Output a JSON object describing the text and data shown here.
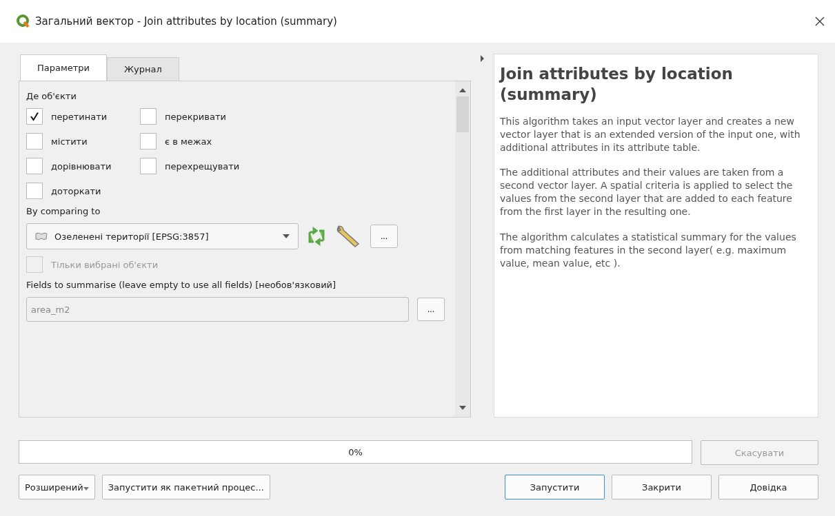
{
  "window": {
    "title": "Загальний вектор - Join attributes by location (summary)"
  },
  "tabs": [
    {
      "label": "Параметри",
      "selected": true
    },
    {
      "label": "Журнал",
      "selected": false
    }
  ],
  "predicate": {
    "label": "Де об'єкти",
    "options": [
      {
        "label": "перетинати",
        "checked": true
      },
      {
        "label": "перекривати",
        "checked": false
      },
      {
        "label": "містити",
        "checked": false
      },
      {
        "label": "є в межах",
        "checked": false
      },
      {
        "label": "дорівнювати",
        "checked": false
      },
      {
        "label": "перехрещувати",
        "checked": false
      },
      {
        "label": "доторкати",
        "checked": false
      }
    ]
  },
  "comparing": {
    "label": "By comparing to",
    "layer": "Озеленені території [EPSG:3857]",
    "more": "...",
    "selected_only": {
      "label": "Тільки вибрані об'єкти",
      "checked": false,
      "disabled": true
    }
  },
  "fields": {
    "label": "Fields to summarise (leave empty to use all fields) [необов'язковий]",
    "value": "area_m2",
    "more": "..."
  },
  "help": {
    "title": "Join attributes by location (summary)",
    "paragraphs": [
      "This algorithm takes an input vector layer and creates a new vector layer that is an extended version of the input one, with additional attributes in its attribute table.",
      "The additional attributes and their values are taken from a second vector layer. A spatial criteria is applied to select the values from the second layer that are added to each feature from the first layer in the resulting one.",
      "The algorithm calculates a statistical summary for the values from matching features in the second layer( e.g. maximum value, mean value, etc )."
    ]
  },
  "progress": {
    "level": 0,
    "reading": "0%"
  },
  "cancel": {
    "label": "Скасувати",
    "disabled": true
  },
  "buttons_left": [
    {
      "label": "Розширений",
      "kind": "dropdown"
    },
    {
      "label": "Запустити як пакетний процес...",
      "kind": "plain"
    }
  ],
  "buttons_right": [
    {
      "label": "Запустити",
      "kind": "default"
    },
    {
      "label": "Закрити",
      "kind": "plain"
    },
    {
      "label": "Довідка",
      "kind": "plain"
    }
  ]
}
